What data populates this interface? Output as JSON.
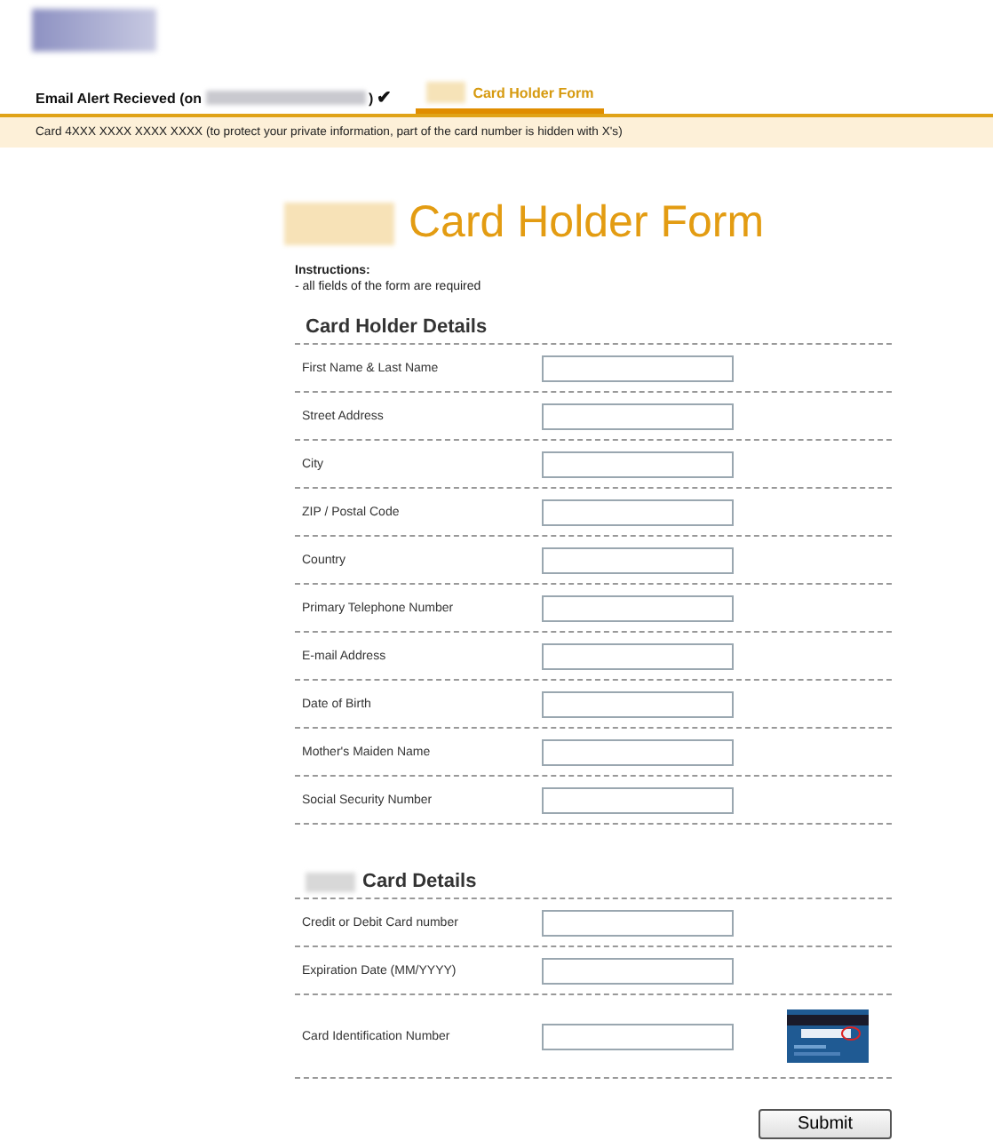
{
  "header": {
    "alert_label": "Email Alert Recieved (on",
    "alert_suffix": ")",
    "alert_mark": "✔",
    "tabs": [
      {
        "label": "Card Holder Form",
        "selected": true
      }
    ]
  },
  "notice": "Card 4XXX XXXX XXXX XXXX (to protect your private information, part of the card number is hidden with X's)",
  "form": {
    "title": "Card Holder Form",
    "instructions_title": "Instructions:",
    "instructions": "- all fields of the form are required",
    "sections": [
      {
        "heading": "Card Holder Details",
        "fields": [
          {
            "label": "First Name & Last Name",
            "kind": "text"
          },
          {
            "label": "Street Address",
            "kind": "text"
          },
          {
            "label": "City",
            "kind": "text"
          },
          {
            "label": "ZIP / Postal Code",
            "kind": "text"
          },
          {
            "label": "Country",
            "kind": "text"
          },
          {
            "label": "Primary Telephone Number",
            "kind": "text"
          },
          {
            "label": "E-mail Address",
            "kind": "text"
          },
          {
            "label": "Date of Birth",
            "kind": "text"
          },
          {
            "label": "Mother's Maiden Name",
            "kind": "text"
          },
          {
            "label": "Social Security Number",
            "kind": "text"
          }
        ]
      },
      {
        "heading": "Card Details",
        "fields": [
          {
            "label": "Credit or Debit Card number",
            "kind": "text"
          },
          {
            "label": "Expiration Date (MM/YYYY)",
            "kind": "text"
          },
          {
            "label": "Card Identification Number",
            "kind": "card-code"
          }
        ]
      }
    ],
    "submit": "Submit"
  }
}
